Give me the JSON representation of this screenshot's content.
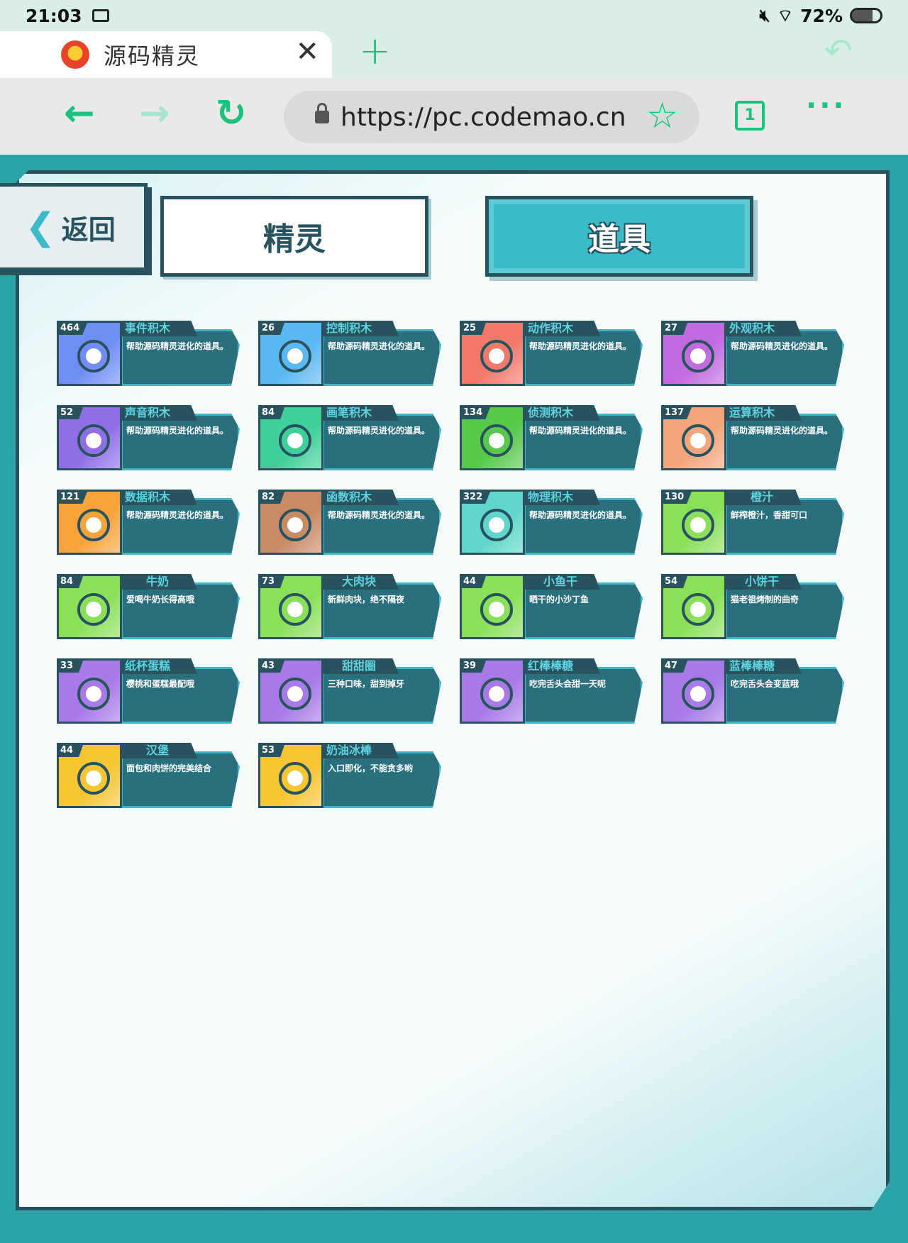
{
  "status_bar": {
    "time": "21:03",
    "battery": "72%",
    "battery_level": 0.72
  },
  "browser": {
    "tab_title": "源码精灵",
    "url": "https://pc.codemao.cn",
    "tab_count": "1"
  },
  "game": {
    "back_label": "返回",
    "tab_sprites": "精灵",
    "tab_props": "道具",
    "items": [
      {
        "count": "464",
        "name": "事件积木",
        "desc": "帮助源码精灵进化的道具。",
        "color": "#6f8ef5"
      },
      {
        "count": "26",
        "name": "控制积木",
        "desc": "帮助源码精灵进化的道具。",
        "color": "#5ab8f2"
      },
      {
        "count": "25",
        "name": "动作积木",
        "desc": "帮助源码精灵进化的道具。",
        "color": "#f2796a"
      },
      {
        "count": "27",
        "name": "外观积木",
        "desc": "帮助源码精灵进化的道具。",
        "color": "#c26be0"
      },
      {
        "count": "52",
        "name": "声音积木",
        "desc": "帮助源码精灵进化的道具。",
        "color": "#8f6ee8"
      },
      {
        "count": "84",
        "name": "画笔积木",
        "desc": "帮助源码精灵进化的道具。",
        "color": "#3fcf98"
      },
      {
        "count": "134",
        "name": "侦测积木",
        "desc": "帮助源码精灵进化的道具。",
        "color": "#56c94a"
      },
      {
        "count": "137",
        "name": "运算积木",
        "desc": "帮助源码精灵进化的道具。",
        "color": "#f3a67c"
      },
      {
        "count": "121",
        "name": "数据积木",
        "desc": "帮助源码精灵进化的道具。",
        "color": "#f7a33a"
      },
      {
        "count": "82",
        "name": "函数积木",
        "desc": "帮助源码精灵进化的道具。",
        "color": "#c98a66"
      },
      {
        "count": "322",
        "name": "物理积木",
        "desc": "帮助源码精灵进化的道具。",
        "color": "#5ed6c8"
      },
      {
        "count": "130",
        "name": "橙汁",
        "desc": "鲜榨橙汁，香甜可口",
        "color": "#8be05a"
      },
      {
        "count": "84",
        "name": "牛奶",
        "desc": "爱喝牛奶长得高哦",
        "color": "#8be05a"
      },
      {
        "count": "73",
        "name": "大肉块",
        "desc": "新鲜肉块，绝不隔夜",
        "color": "#8be05a"
      },
      {
        "count": "44",
        "name": "小鱼干",
        "desc": "晒干的小沙丁鱼",
        "color": "#8be05a"
      },
      {
        "count": "54",
        "name": "小饼干",
        "desc": "猫老祖烤制的曲奇",
        "color": "#8be05a"
      },
      {
        "count": "33",
        "name": "纸杯蛋糕",
        "desc": "樱桃和蛋糕最配哦",
        "color": "#a77ae8"
      },
      {
        "count": "43",
        "name": "甜甜圈",
        "desc": "三种口味，甜到掉牙",
        "color": "#a77ae8"
      },
      {
        "count": "39",
        "name": "红棒棒糖",
        "desc": "吃完舌头会甜一天呢",
        "color": "#a77ae8"
      },
      {
        "count": "47",
        "name": "蓝棒棒糖",
        "desc": "吃完舌头会变蓝哦",
        "color": "#a77ae8"
      },
      {
        "count": "44",
        "name": "汉堡",
        "desc": "面包和肉饼的完美结合",
        "color": "#f7c531"
      },
      {
        "count": "53",
        "name": "奶油冰棒",
        "desc": "入口即化，不能贪多哟",
        "color": "#f7c531"
      }
    ]
  }
}
